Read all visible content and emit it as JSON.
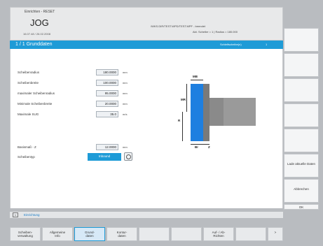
{
  "header": {
    "mode_small": "Einrichten - RESET",
    "mode_big": "JOG",
    "date": "16.07.48 / 26.02.2008",
    "program": "/WKS.DIR/TEST.WPD/TEST.MPF - beendet",
    "info": "Akt. Scheibe = 1  |  Radius = 180.000"
  },
  "titlebar": {
    "title": "1 / 1 Grunddaten",
    "status1": "Schleifscheibe(n)",
    "status2": "1"
  },
  "params": [
    {
      "label": "Scheibenradius",
      "value": "180.0000",
      "unit": "mm"
    },
    {
      "label": "Scheibenbreite",
      "value": "100.0000",
      "unit": "mm"
    },
    {
      "label": "maximaler Scheibenradius",
      "value": "95.0000",
      "unit": "mm"
    },
    {
      "label": "Minimale Scheibenbreite",
      "value": "20.0000",
      "unit": "mm"
    },
    {
      "label": "Maximale SUG",
      "value": "35.0",
      "unit": "m/s"
    }
  ],
  "basemass": {
    "label": "Basismaß - Z",
    "value": "12.0000",
    "unit": "mm"
  },
  "wheeltype": {
    "label": "Scheibentyp",
    "value": "Inbound"
  },
  "diagram": {
    "label_mb": "MB",
    "label_mr": "MR",
    "label_r": "R",
    "label_br": "Br",
    "label_z": "Z"
  },
  "softkeys_right": [
    "",
    "",
    "",
    "",
    "",
    "",
    "Lade aktuelle Daten",
    "Abbrechen",
    "OK"
  ],
  "status": {
    "toggle": "<",
    "text": "Einrichtung"
  },
  "softkeys_bottom": [
    {
      "label": "Scheiben-\nverwaltung",
      "active": false
    },
    {
      "label": "Allgemeine\nInfo",
      "active": false
    },
    {
      "label": "Grund-\ndaten",
      "active": true
    },
    {
      "label": "Kontur-\ndaten",
      "active": false
    },
    {
      "label": "",
      "active": false
    },
    {
      "label": "",
      "active": false
    },
    {
      "label": "Auf- / Ab-\nRichten",
      "active": false
    },
    {
      "label": "",
      "active": false
    },
    {
      "label": ">",
      "active": false
    }
  ],
  "colors": {
    "accent": "#1e9bd7",
    "wheel": "#1e7fe0"
  }
}
